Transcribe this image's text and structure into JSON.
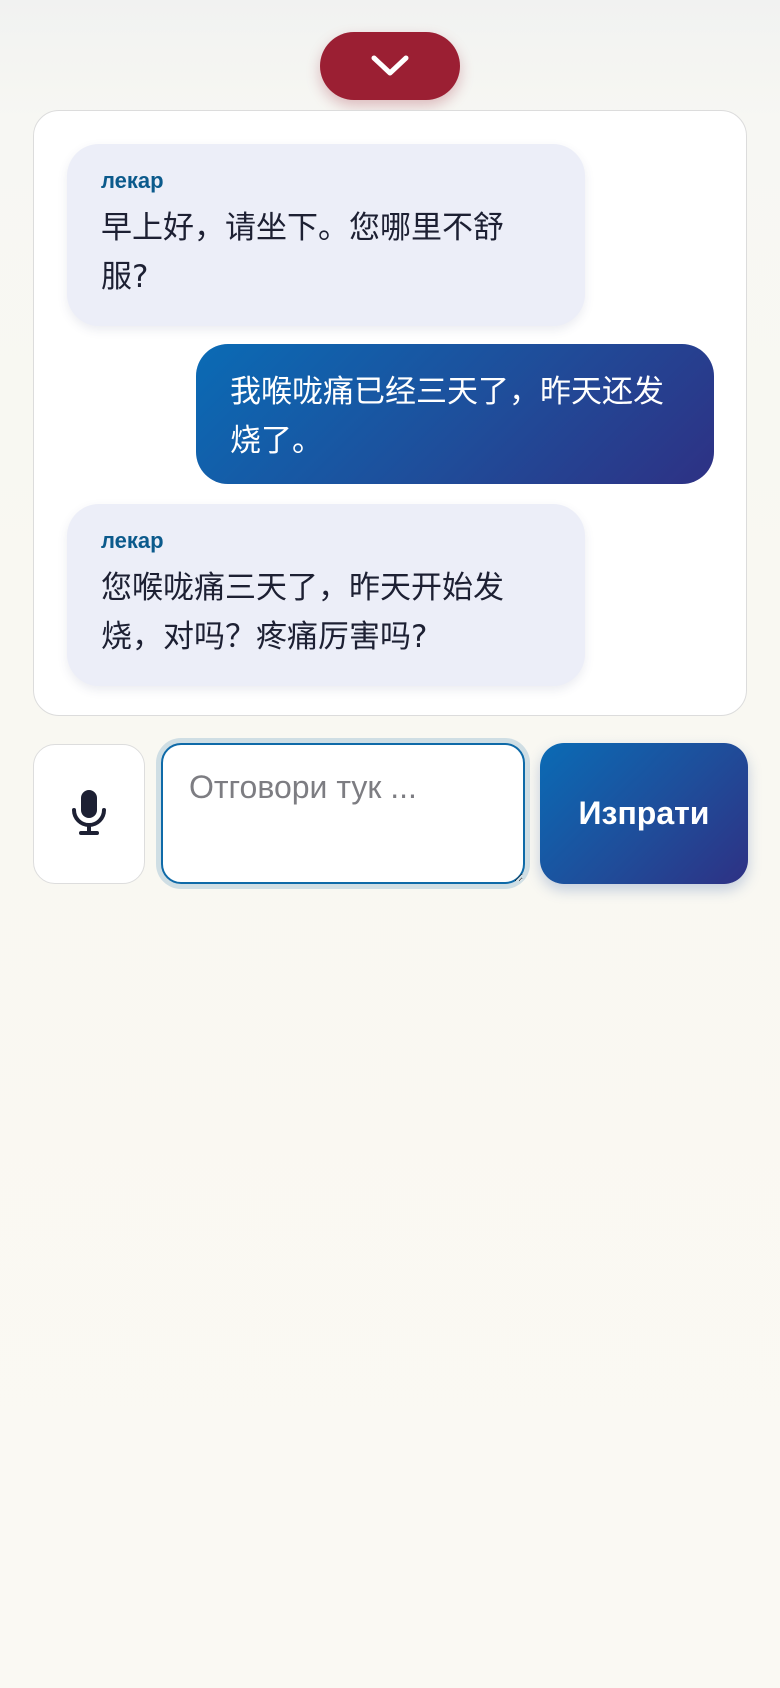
{
  "collapse_button": {
    "icon": "chevron-down-icon"
  },
  "messages": [
    {
      "role": "doctor",
      "speaker": "лекар",
      "text": "早上好，请坐下。您哪里不舒服?"
    },
    {
      "role": "patient",
      "speaker": "",
      "text": "我喉咙痛已经三天了，昨天还发烧了。"
    },
    {
      "role": "doctor",
      "speaker": "лекар",
      "text": "您喉咙痛三天了，昨天开始发烧，对吗？疼痛厉害吗?"
    }
  ],
  "composer": {
    "mic_icon": "microphone-icon",
    "placeholder": "Отговори тук ...",
    "value": "",
    "send_label": "Изпрати"
  },
  "colors": {
    "collapse_button": "#9b1f33",
    "doctor_bubble": "#eceef8",
    "speaker_label": "#0b5a8c",
    "accent_start": "#0a6bb5",
    "accent_end": "#2e3184"
  }
}
